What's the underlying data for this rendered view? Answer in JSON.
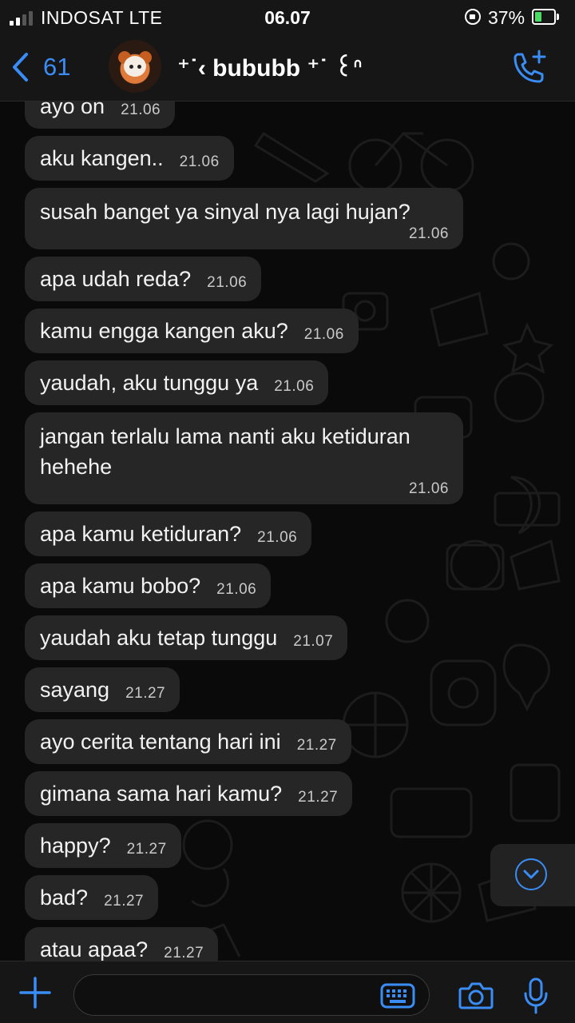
{
  "status_bar": {
    "carrier": "INDOSAT  LTE",
    "time": "06.07",
    "battery_percent": "37%",
    "battery_level": 0.37
  },
  "header": {
    "back_count": "61",
    "contact_name": "⁺˙‹ bububb ⁺˙ ꒰ᐢ",
    "icons": {
      "back": "chevron-left-icon",
      "call": "phone-plus-icon"
    }
  },
  "messages": [
    {
      "text": "ayo on",
      "time": "21.06"
    },
    {
      "text": "aku kangen..",
      "time": "21.06"
    },
    {
      "text": "susah banget ya sinyal nya lagi hujan?",
      "time": "21.06",
      "multi": true
    },
    {
      "text": "apa udah reda?",
      "time": "21.06"
    },
    {
      "text": "kamu engga kangen aku?",
      "time": "21.06"
    },
    {
      "text": "yaudah, aku tunggu ya",
      "time": "21.06"
    },
    {
      "text": "jangan terlalu lama nanti aku ketiduran hehehe",
      "time": "21.06",
      "multi": true
    },
    {
      "text": "apa kamu ketiduran?",
      "time": "21.06"
    },
    {
      "text": "apa kamu bobo?",
      "time": "21.06"
    },
    {
      "text": "yaudah aku tetap tunggu",
      "time": "21.07"
    },
    {
      "text": "sayang",
      "time": "21.27"
    },
    {
      "text": "ayo cerita tentang hari ini",
      "time": "21.27"
    },
    {
      "text": "gimana sama hari kamu?",
      "time": "21.27"
    },
    {
      "text": "happy?",
      "time": "21.27"
    },
    {
      "text": "bad?",
      "time": "21.27"
    },
    {
      "text": "atau apaa?",
      "time": "21.27"
    }
  ],
  "input_bar": {
    "placeholder": "",
    "icons": {
      "plus": "plus-icon",
      "keyboard": "keyboard-icon",
      "camera": "camera-icon",
      "microphone": "microphone-icon"
    }
  },
  "colors": {
    "accent": "#3b8df6",
    "bubble": "#262626",
    "background": "#0a0a0a",
    "bar": "#161616"
  }
}
